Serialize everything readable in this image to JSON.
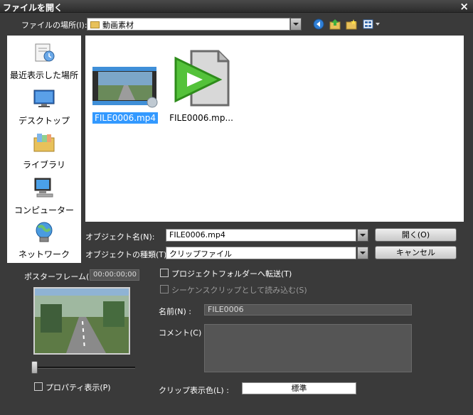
{
  "window": {
    "title": "ファイルを開く",
    "close_glyph": "×"
  },
  "lookin": {
    "label": "ファイルの場所(I):",
    "value": "動画素材"
  },
  "places": [
    {
      "label": "最近表示した場所",
      "icon": "recent-places-icon"
    },
    {
      "label": "デスクトップ",
      "icon": "desktop-icon"
    },
    {
      "label": "ライブラリ",
      "icon": "library-icon"
    },
    {
      "label": "コンピューター",
      "icon": "computer-icon"
    },
    {
      "label": "ネットワーク",
      "icon": "network-icon"
    }
  ],
  "files": [
    {
      "name": "FILE0006.mp4",
      "selected": true
    },
    {
      "name": "FILE0006.mp...",
      "selected": false
    }
  ],
  "object_name": {
    "label": "オブジェクト名(N):",
    "value": "FILE0006.mp4"
  },
  "object_type": {
    "label": "オブジェクトの種類(T):",
    "value": "クリップファイル"
  },
  "buttons": {
    "open": "開く(O)",
    "cancel": "キャンセル"
  },
  "poster": {
    "label": "ポスターフレーム(R) :",
    "timecode": "00:00:00;00"
  },
  "options": {
    "transfer": "プロジェクトフォルダーへ転送(T)",
    "sequence": "シーケンスクリップとして読み込む(S)",
    "property": "プロパティ表示(P)"
  },
  "name_field": {
    "label": "名前(N) :",
    "value": "FILE0006"
  },
  "comment": {
    "label": "コメント(C) :",
    "value": ""
  },
  "clip_color": {
    "label": "クリップ表示色(L) :",
    "value": "標準"
  },
  "colors": {
    "accent": "#3399ff",
    "dialog_bg": "#3a3a3a"
  }
}
